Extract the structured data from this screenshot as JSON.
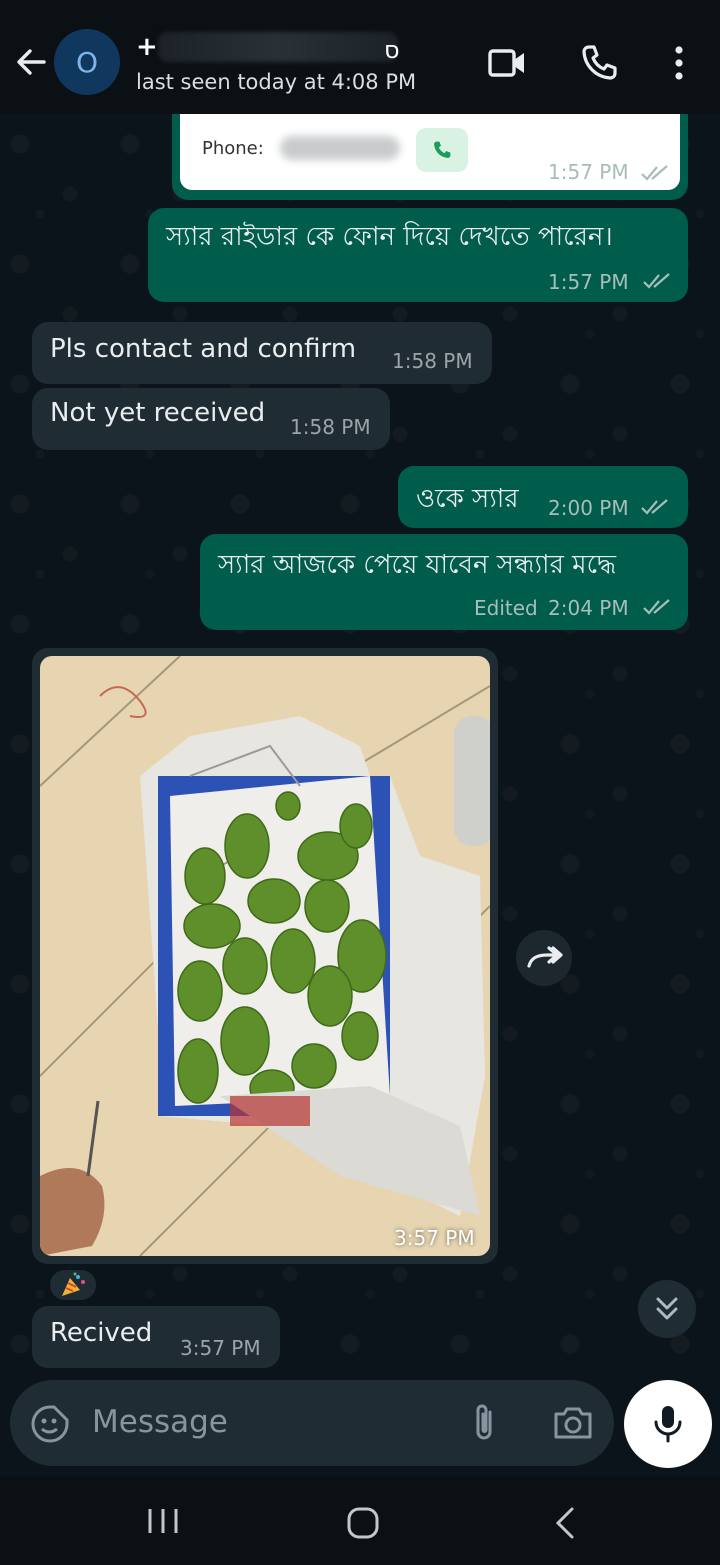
{
  "header": {
    "contact_initial": "O",
    "contact_name_visible_prefix": "+",
    "contact_name_visible_suffix": "ס",
    "last_seen": "last seen today at 4:08 PM"
  },
  "contact_card": {
    "label": "Phone:",
    "time": "1:57 PM"
  },
  "messages": [
    {
      "direction": "out",
      "text": "স্যার রাইডার কে ফোন দিয়ে দেখতে পারেন।",
      "time": "1:57 PM",
      "status": "read"
    },
    {
      "direction": "in",
      "text": "Pls contact and confirm",
      "time": "1:58 PM"
    },
    {
      "direction": "in",
      "text": "Not yet received",
      "time": "1:58 PM"
    },
    {
      "direction": "out",
      "text": "ওকে স্যার",
      "time": "2:00 PM",
      "status": "read"
    },
    {
      "direction": "out",
      "text": "স্যার আজকে পেয়ে যাবেন সন্ধ্যার মদ্ধে",
      "time": "2:04 PM",
      "edited_label": "Edited",
      "status": "read"
    },
    {
      "direction": "in",
      "type": "image",
      "time": "3:57 PM",
      "reaction": "party-popper"
    },
    {
      "direction": "in",
      "text": "Recived",
      "time": "3:57 PM"
    }
  ],
  "input": {
    "placeholder": "Message"
  },
  "colors": {
    "outgoing_bubble": "#005c4b",
    "incoming_bubble": "#202c33",
    "background": "#0b141a",
    "read_ticks": "#a7bdb9"
  },
  "icons": [
    "back-arrow-icon",
    "video-call-icon",
    "voice-call-icon",
    "more-options-icon",
    "forward-icon",
    "scroll-down-icon",
    "emoji-sticker-icon",
    "attach-icon",
    "camera-icon",
    "mic-icon",
    "nav-recents-icon",
    "nav-home-icon",
    "nav-back-icon"
  ]
}
